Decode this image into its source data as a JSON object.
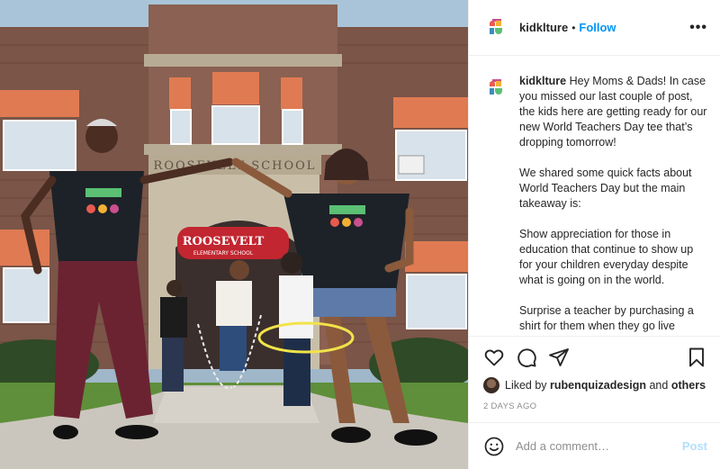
{
  "post": {
    "username": "kidklture",
    "follow_label": "Follow",
    "more_label": "•••",
    "caption_paragraphs": [
      "Hey Moms & Dads! In case you missed our last couple of post, the kids here are getting ready for our new World Teachers Day tee that’s dropping tomorrow!",
      "We shared some quick facts about World Teachers Day but the main takeaway is:",
      "Show appreciation for those in education that continue to show up for your children everyday despite what is going on in the world.",
      "Surprise a teacher by purchasing a shirt for them when they go live tomorrow. Tag some parents below so they can do the same."
    ],
    "liked_prefix": "Liked by",
    "liked_user": "rubenquizadesign",
    "liked_and": "and",
    "liked_others": "others",
    "time_ago": "2 DAYS AGO",
    "comment_placeholder": "Add a comment…",
    "post_label": "Post"
  },
  "photo": {
    "building_sign": "ROOSEVELT SCHOOL",
    "door_sign": "ROOSEVELT",
    "door_sign_sub": "ELEMENTARY SCHOOL"
  },
  "icons": {
    "like": "heart-icon",
    "comment": "comment-icon",
    "share": "share-icon",
    "save": "bookmark-icon",
    "emoji": "smiley-icon",
    "more": "more-icon"
  },
  "colors": {
    "follow": "#0095f6",
    "post_disabled": "#b2dffc",
    "muted": "#8e8e8e",
    "text": "#262626"
  }
}
